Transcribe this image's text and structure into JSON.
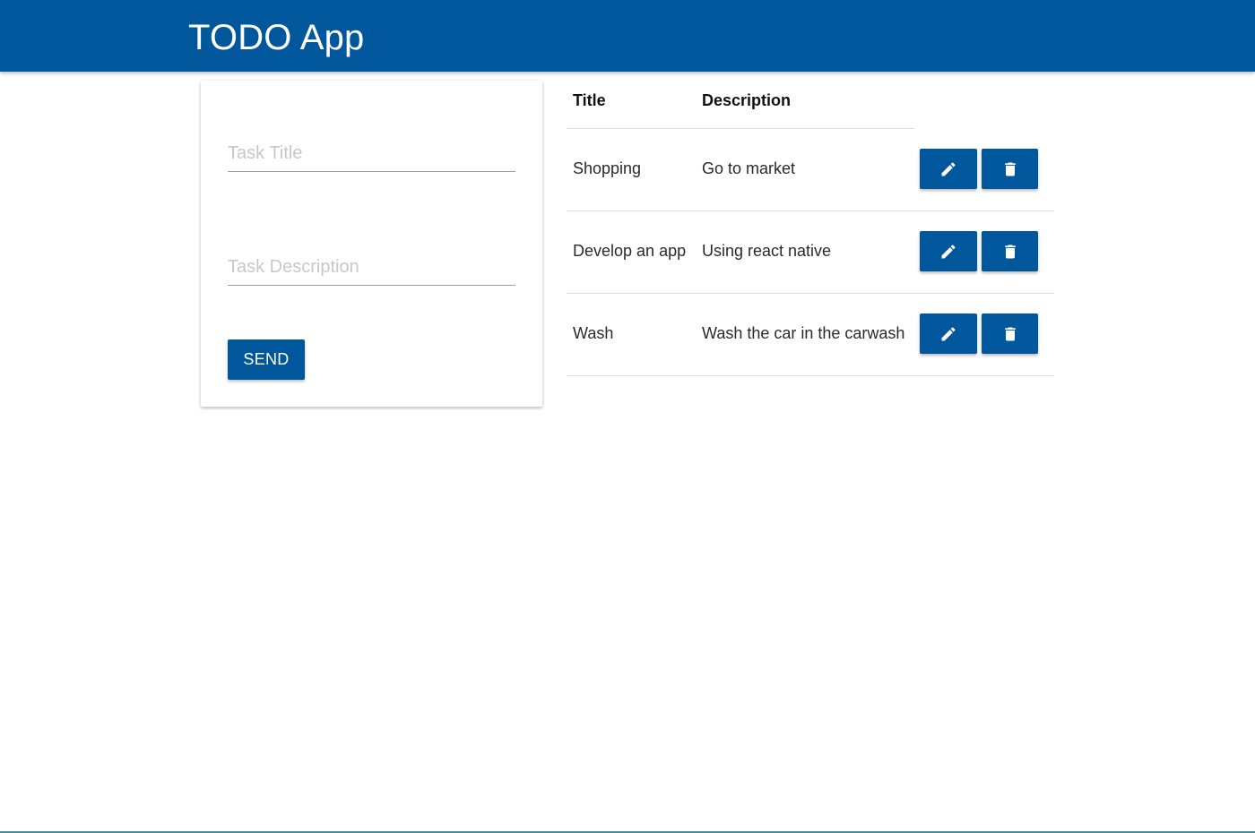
{
  "app": {
    "title": "TODO App",
    "brand_color": "#01579b"
  },
  "form": {
    "title_placeholder": "Task Title",
    "title_value": "",
    "description_placeholder": "Task Description",
    "description_value": "",
    "send_label": "SEND"
  },
  "table": {
    "headers": {
      "title": "Title",
      "description": "Description"
    },
    "rows": [
      {
        "title": "Shopping",
        "description": "Go to market",
        "edit_icon": "pencil-icon",
        "delete_icon": "trash-icon"
      },
      {
        "title": "Develop an app",
        "description": "Using react native",
        "edit_icon": "pencil-icon",
        "delete_icon": "trash-icon"
      },
      {
        "title": "Wash",
        "description": "Wash the car in the carwash",
        "edit_icon": "pencil-icon",
        "delete_icon": "trash-icon"
      }
    ]
  }
}
